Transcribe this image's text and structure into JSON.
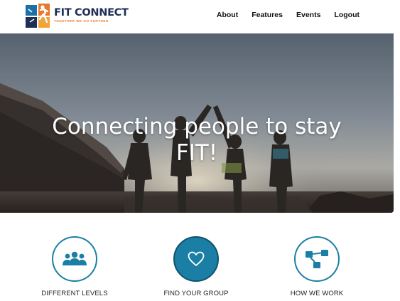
{
  "header": {
    "brand": "FIT CONNECT",
    "tagline": "TOGETHER WE GO FURTHER",
    "nav": [
      "About",
      "Features",
      "Events",
      "Logout"
    ]
  },
  "hero": {
    "title_line1": "Connecting people to stay",
    "title_line2": "FIT!"
  },
  "features": [
    {
      "label": "DIFFERENT LEVELS",
      "icon": "group-icon"
    },
    {
      "label": "FIND YOUR GROUP",
      "icon": "heart-icon"
    },
    {
      "label": "HOW WE WORK",
      "icon": "workflow-icon"
    }
  ],
  "colors": {
    "accent": "#1b7fa5",
    "brand_navy": "#1d2e57",
    "brand_orange": "#e8762b"
  }
}
